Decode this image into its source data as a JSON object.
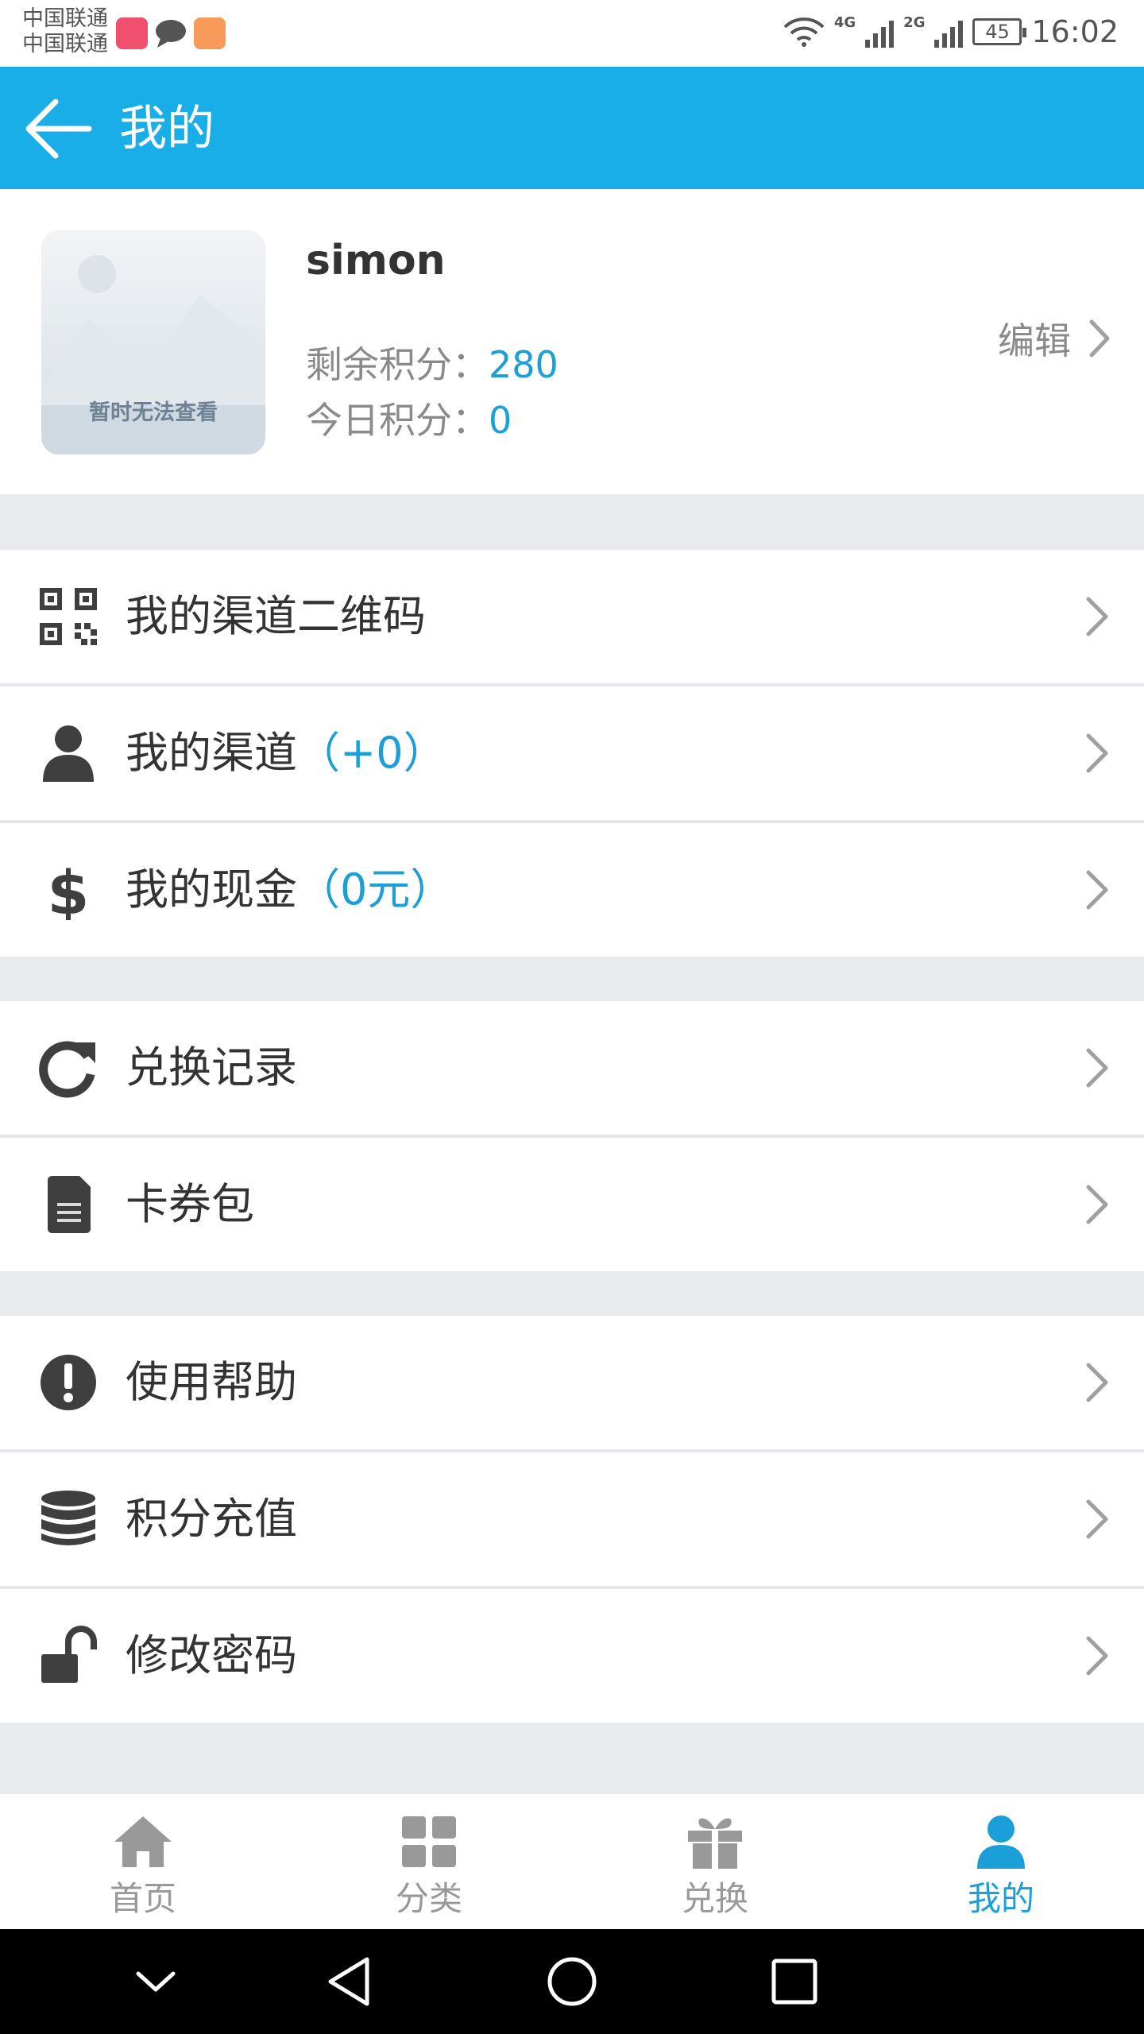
{
  "status_bar": {
    "carrier_1": "中国联通",
    "carrier_2": "中国联通",
    "net_1": "4G",
    "net_2": "2G",
    "battery": "45",
    "time": "16:02"
  },
  "header": {
    "title": "我的"
  },
  "profile": {
    "avatar_placeholder": "暂时无法查看",
    "username": "simon",
    "remaining_label": "剩余积分：",
    "remaining_value": "280",
    "today_label": "今日积分：",
    "today_value": "0",
    "edit_label": "编辑"
  },
  "menu_groups": [
    [
      {
        "icon": "qr-code-icon",
        "label": "我的渠道二维码",
        "extra": ""
      },
      {
        "icon": "person-icon",
        "label": "我的渠道",
        "extra": "（+0）"
      },
      {
        "icon": "dollar-icon",
        "label": "我的现金",
        "extra": "（0元）"
      }
    ],
    [
      {
        "icon": "refresh-icon",
        "label": "兑换记录",
        "extra": ""
      },
      {
        "icon": "document-icon",
        "label": "卡券包",
        "extra": ""
      }
    ],
    [
      {
        "icon": "exclamation-icon",
        "label": "使用帮助",
        "extra": ""
      },
      {
        "icon": "database-icon",
        "label": "积分充值",
        "extra": ""
      },
      {
        "icon": "unlock-icon",
        "label": "修改密码",
        "extra": ""
      }
    ]
  ],
  "bottom_nav": [
    {
      "icon": "home-icon",
      "label": "首页",
      "active": false
    },
    {
      "icon": "grid-icon",
      "label": "分类",
      "active": false
    },
    {
      "icon": "gift-icon",
      "label": "兑换",
      "active": false
    },
    {
      "icon": "user-icon",
      "label": "我的",
      "active": true
    }
  ],
  "colors": {
    "primary": "#1aaee8",
    "accent_text": "#1a9fd8",
    "icon": "#3f3f3f",
    "inactive": "#999999",
    "background": "#e9eaee"
  }
}
